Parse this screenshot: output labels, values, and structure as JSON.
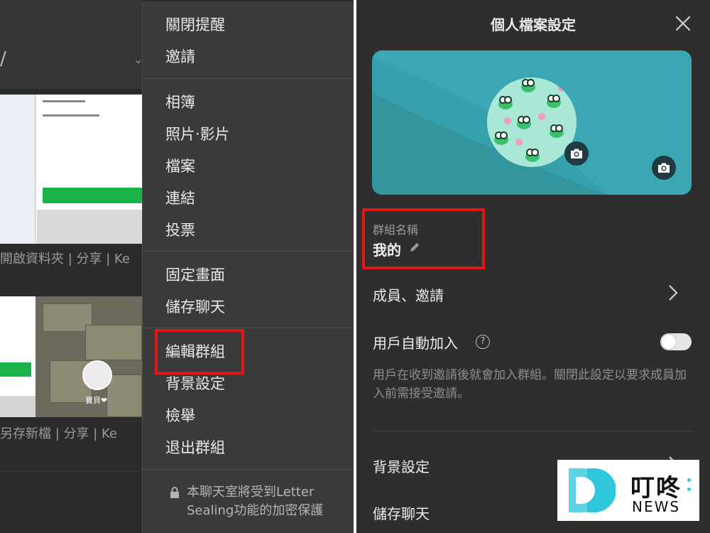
{
  "left_panel": {
    "caption_1": "開啟資料夾 | 分享 | Ke",
    "caption_2": "另存新檔 | 分享 | Ke",
    "avatar_name": "寶貝❤"
  },
  "context_menu": {
    "groups": [
      [
        "關閉提醒",
        "邀請"
      ],
      [
        "相簿",
        "照片‧影片",
        "檔案",
        "連結",
        "投票"
      ],
      [
        "固定畫面",
        "儲存聊天"
      ],
      [
        "編輯群組",
        "背景設定",
        "檢舉",
        "退出群組"
      ]
    ],
    "lock_note_line1": "本聊天室將受到Letter",
    "lock_note_line2": "Sealing功能的加密保護"
  },
  "settings": {
    "title": "個人檔案設定",
    "group_name_label": "群組名稱",
    "group_name_value": "我的",
    "members_invite": "成員、邀請",
    "auto_join_label": "用戶自動加入",
    "auto_join_help": "?",
    "auto_join_enabled": false,
    "auto_join_description": "用戶在收到邀請後就會加入群組。關閉此設定以要求成員加入前需接受邀請。",
    "background_settings": "背景設定",
    "save_chat": "儲存聊天"
  },
  "watermark": {
    "brand_cn": "叮咚",
    "brand_en": "NEWS"
  },
  "colors": {
    "panel_bg": "#2e2e2e",
    "menu_bg": "#3a3a3a",
    "cover_teal": "#36a0ad",
    "highlight_red": "#e01717",
    "brand_cyan": "#2ec7d9"
  }
}
